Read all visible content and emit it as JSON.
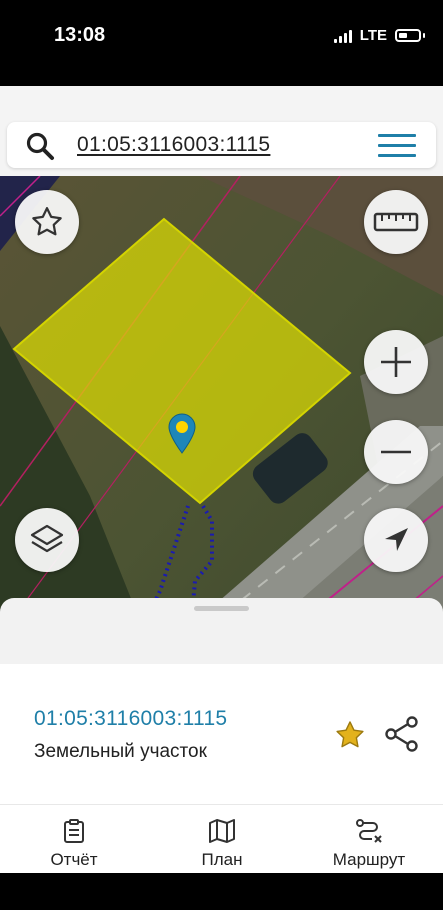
{
  "status_bar": {
    "time": "13:08",
    "network": "LTE"
  },
  "search": {
    "query": "01:05:3116003:1115"
  },
  "map": {
    "parcel_fill_color": "#e6e600",
    "boundary_color": "#d4d400",
    "route_color": "#1a1ab0"
  },
  "parcel": {
    "number": "01:05:3116003:1115",
    "type": "Земельный участок",
    "favorite_color": "#e3b21c"
  },
  "accent_color": "#1f7fa8",
  "tabs": [
    {
      "label": "Отчёт",
      "icon": "report-icon"
    },
    {
      "label": "План",
      "icon": "map-plan-icon"
    },
    {
      "label": "Маршрут",
      "icon": "route-icon"
    }
  ]
}
